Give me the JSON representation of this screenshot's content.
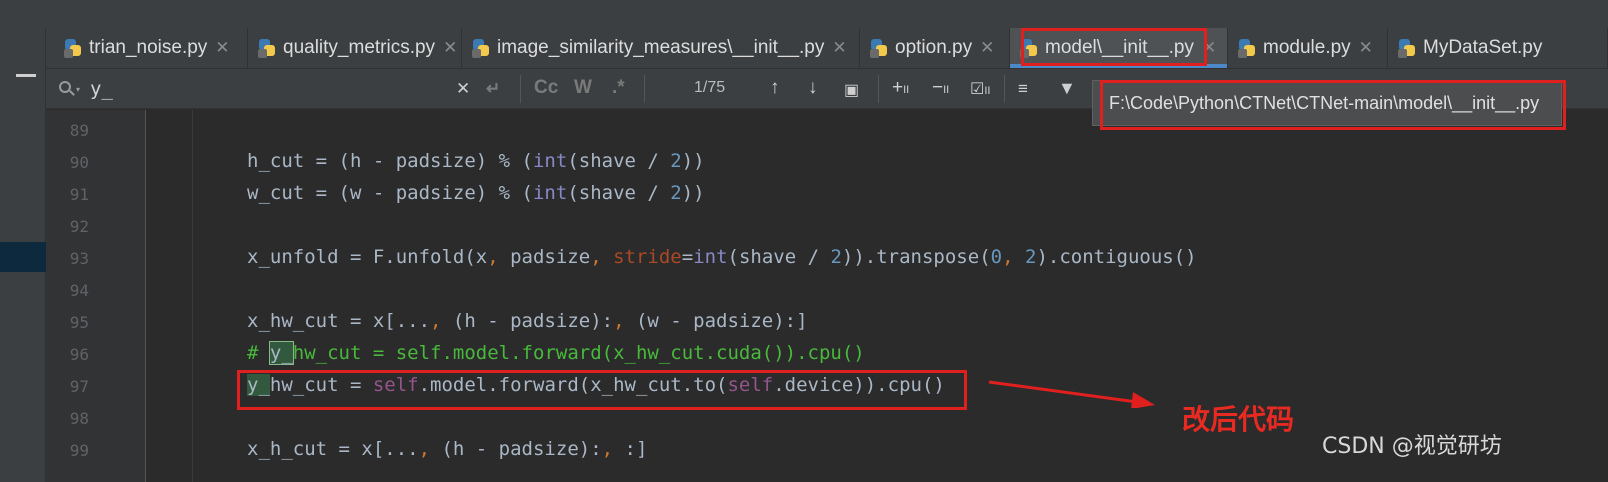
{
  "tabs": [
    {
      "label": "trian_noise.py"
    },
    {
      "label": "quality_metrics.py"
    },
    {
      "label": "image_similarity_measures\\__init__.py"
    },
    {
      "label": "option.py"
    },
    {
      "label": "model\\__init__.py"
    },
    {
      "label": "module.py"
    },
    {
      "label": "MyDataSet.py"
    }
  ],
  "active_tab": "model\\__init__.py",
  "search": {
    "query": "y_",
    "match_count": "1/75",
    "case_label": "Cc",
    "words_label": "W",
    "regex_label": ".*"
  },
  "path_tooltip": "F:\\Code\\Python\\CTNet\\CTNet-main\\model\\__init__.py",
  "editor": {
    "line_numbers": [
      "89",
      "90",
      "91",
      "92",
      "93",
      "94",
      "95",
      "96",
      "97",
      "98",
      "99"
    ]
  },
  "annotation": {
    "label": "改后代码",
    "color": "#e0201e"
  },
  "watermark": "CSDN @视觉研坊",
  "colors": {
    "tab_active_underline": "#4a88c7",
    "highlight": "#32593d",
    "comment": "#48b93b"
  }
}
